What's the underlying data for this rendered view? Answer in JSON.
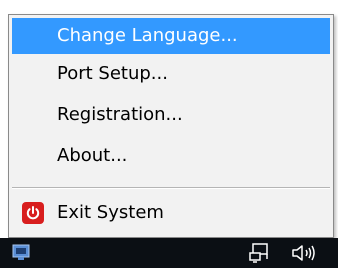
{
  "menu": {
    "items": [
      {
        "label": "Change Language...",
        "highlighted": true
      },
      {
        "label": "Port Setup..."
      },
      {
        "label": "Registration..."
      },
      {
        "label": "About..."
      }
    ],
    "exit": {
      "label": "Exit System",
      "icon": "power-icon"
    }
  },
  "taskbar": {
    "icons": [
      "app-tray-icon",
      "network-icon",
      "volume-icon"
    ]
  },
  "colors": {
    "highlight": "#3399ff",
    "exit_icon": "#d81e1e",
    "taskbar": "#0b0f14"
  }
}
